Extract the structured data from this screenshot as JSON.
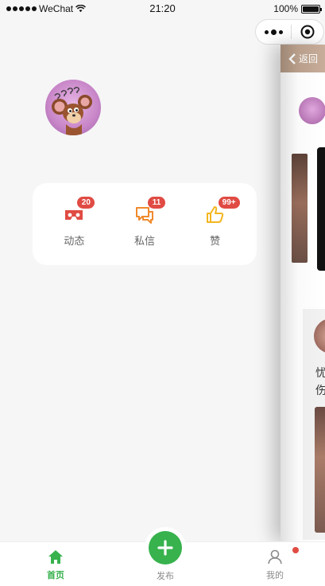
{
  "status_bar": {
    "carrier": "WeChat",
    "time": "21:20",
    "battery": "100%",
    "battery_level": 1.0
  },
  "capsule": {
    "more_icon": "more-dots-icon",
    "close_icon": "target-circle-icon"
  },
  "drawer": {
    "avatar_icon": "cartoon-mouse-avatar",
    "stats": [
      {
        "label": "动态",
        "badge": "20",
        "icon": "vr-glasses-icon",
        "color": "#e04b43"
      },
      {
        "label": "私信",
        "badge": "11",
        "icon": "chat-bubbles-icon",
        "color": "#f08a2c"
      },
      {
        "label": "赞",
        "badge": "99+",
        "icon": "thumbs-up-icon",
        "color": "#f3b61f"
      }
    ]
  },
  "main_peek": {
    "back_label": "返回",
    "text": "忧\n伤"
  },
  "tabbar": {
    "home": "首页",
    "publish": "发布",
    "me": "我的"
  },
  "colors": {
    "accent": "#37b24d",
    "badge": "#e04b43",
    "background": "#f6f6f6"
  }
}
